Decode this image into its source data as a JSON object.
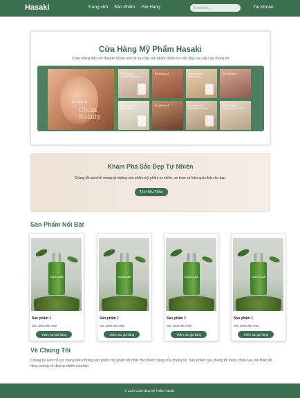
{
  "header": {
    "logo": "Hasaki",
    "nav": [
      "Trang chủ",
      "Sản Phẩm",
      "Giỏ Hàng"
    ],
    "search_placeholder": "Tìm kiếm...",
    "account": "Tài Khoản"
  },
  "hero": {
    "title": "Cửa Hàng Mỹ Phẩm Hasaki",
    "subtitle": "Chào mừng đến với Hasaki! Khám phá bộ sưu tập sản phẩm chăm sóc sắc đẹp cao cấp của chúng tôi",
    "banner": {
      "feature_word": "Clean Beauty",
      "feature_brand": "Be Natural",
      "tiles": [
        "Be Natural\nGentle Products",
        "Be Natural",
        "Be Natural\nBasic Set",
        "Be Natural",
        "Be Natural\nHydrating",
        "Be Natural",
        "Be Natural\nEat Better Skin",
        "Be Natural\nSkincare Routine"
      ]
    }
  },
  "promo": {
    "title": "Khám Phá Sắc Đẹp Tự Nhiên",
    "text": "Chúng tôi cam kết mang lại những sản phẩm mỹ phẩm tự nhiên, an toàn và hiệu quả nhất cho bạn.",
    "button": "Tìm Hiểu Thêm"
  },
  "featured": {
    "title": "Sản Phẩm Nổi Bật",
    "products": [
      {
        "name": "Sản phẩm 1",
        "price": "Giá: 1000.000 VNĐ",
        "button": "Thêm vào giỏ hàng",
        "label": "SKINCARE"
      },
      {
        "name": "Sản phẩm 1",
        "price": "Giá: 1000.000 VNĐ",
        "button": "Thêm vào giỏ hàng",
        "label": "SKINCARE"
      },
      {
        "name": "Sản phẩm 1",
        "price": "Giá: 1000.000 VNĐ",
        "button": "Thêm vào giỏ hàng",
        "label": "SKINCARE"
      },
      {
        "name": "Sản phẩm 1",
        "price": "Giá: 1000.000 VNĐ",
        "button": "Thêm vào giỏ hàng",
        "label": "SKINCARE"
      }
    ]
  },
  "about": {
    "title": "Về Chúng Tôi",
    "text": "Chúng tôi luôn nỗ lực mang đến những sản phẩm mỹ phẩm tốt nhất cho khách hàng của chúng tôi. Sản phẩm của chúng tôi được chọn lựa cẩn thận để tăng cường vẻ đẹp tự nhiên của bạn."
  },
  "footer": {
    "text": "© 2024 Cửa Hàng Mỹ Phẩm Hasaki."
  },
  "colors": {
    "brand": "#3d6e50",
    "promo_bg": "#efe3d8"
  }
}
